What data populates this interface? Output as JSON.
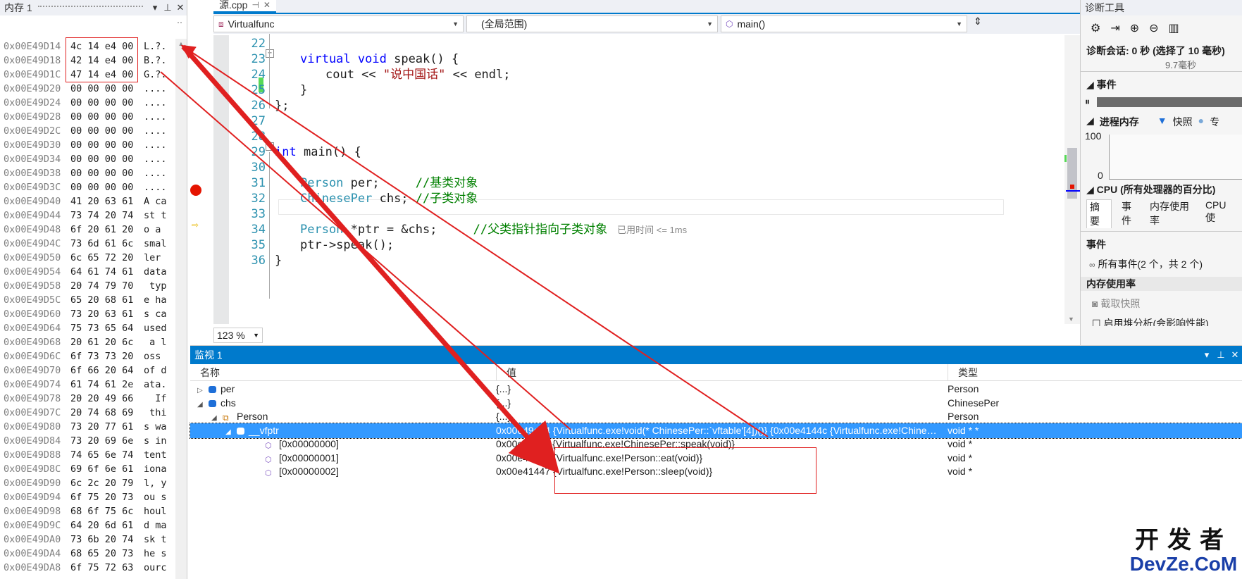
{
  "memory_panel": {
    "title": "内存 1",
    "rows": [
      {
        "addr": "0x00E49D14",
        "bytes": "4c 14 e4 00",
        "ascii": "L.?."
      },
      {
        "addr": "0x00E49D18",
        "bytes": "42 14 e4 00",
        "ascii": "B.?."
      },
      {
        "addr": "0x00E49D1C",
        "bytes": "47 14 e4 00",
        "ascii": "G.?."
      },
      {
        "addr": "0x00E49D20",
        "bytes": "00 00 00 00",
        "ascii": "...."
      },
      {
        "addr": "0x00E49D24",
        "bytes": "00 00 00 00",
        "ascii": "...."
      },
      {
        "addr": "0x00E49D28",
        "bytes": "00 00 00 00",
        "ascii": "...."
      },
      {
        "addr": "0x00E49D2C",
        "bytes": "00 00 00 00",
        "ascii": "...."
      },
      {
        "addr": "0x00E49D30",
        "bytes": "00 00 00 00",
        "ascii": "...."
      },
      {
        "addr": "0x00E49D34",
        "bytes": "00 00 00 00",
        "ascii": "...."
      },
      {
        "addr": "0x00E49D38",
        "bytes": "00 00 00 00",
        "ascii": "...."
      },
      {
        "addr": "0x00E49D3C",
        "bytes": "00 00 00 00",
        "ascii": "...."
      },
      {
        "addr": "0x00E49D40",
        "bytes": "41 20 63 61",
        "ascii": "A ca"
      },
      {
        "addr": "0x00E49D44",
        "bytes": "73 74 20 74",
        "ascii": "st t"
      },
      {
        "addr": "0x00E49D48",
        "bytes": "6f 20 61 20",
        "ascii": "o a "
      },
      {
        "addr": "0x00E49D4C",
        "bytes": "73 6d 61 6c",
        "ascii": "smal"
      },
      {
        "addr": "0x00E49D50",
        "bytes": "6c 65 72 20",
        "ascii": "ler "
      },
      {
        "addr": "0x00E49D54",
        "bytes": "64 61 74 61",
        "ascii": "data"
      },
      {
        "addr": "0x00E49D58",
        "bytes": "20 74 79 70",
        "ascii": " typ"
      },
      {
        "addr": "0x00E49D5C",
        "bytes": "65 20 68 61",
        "ascii": "e ha"
      },
      {
        "addr": "0x00E49D60",
        "bytes": "73 20 63 61",
        "ascii": "s ca"
      },
      {
        "addr": "0x00E49D64",
        "bytes": "75 73 65 64",
        "ascii": "used"
      },
      {
        "addr": "0x00E49D68",
        "bytes": "20 61 20 6c",
        "ascii": " a l"
      },
      {
        "addr": "0x00E49D6C",
        "bytes": "6f 73 73 20",
        "ascii": "oss "
      },
      {
        "addr": "0x00E49D70",
        "bytes": "6f 66 20 64",
        "ascii": "of d"
      },
      {
        "addr": "0x00E49D74",
        "bytes": "61 74 61 2e",
        "ascii": "ata."
      },
      {
        "addr": "0x00E49D78",
        "bytes": "20 20 49 66",
        "ascii": "  If"
      },
      {
        "addr": "0x00E49D7C",
        "bytes": "20 74 68 69",
        "ascii": " thi"
      },
      {
        "addr": "0x00E49D80",
        "bytes": "73 20 77 61",
        "ascii": "s wa"
      },
      {
        "addr": "0x00E49D84",
        "bytes": "73 20 69 6e",
        "ascii": "s in"
      },
      {
        "addr": "0x00E49D88",
        "bytes": "74 65 6e 74",
        "ascii": "tent"
      },
      {
        "addr": "0x00E49D8C",
        "bytes": "69 6f 6e 61",
        "ascii": "iona"
      },
      {
        "addr": "0x00E49D90",
        "bytes": "6c 2c 20 79",
        "ascii": "l, y"
      },
      {
        "addr": "0x00E49D94",
        "bytes": "6f 75 20 73",
        "ascii": "ou s"
      },
      {
        "addr": "0x00E49D98",
        "bytes": "68 6f 75 6c",
        "ascii": "houl"
      },
      {
        "addr": "0x00E49D9C",
        "bytes": "64 20 6d 61",
        "ascii": "d ma"
      },
      {
        "addr": "0x00E49DA0",
        "bytes": "73 6b 20 74",
        "ascii": "sk t"
      },
      {
        "addr": "0x00E49DA4",
        "bytes": "68 65 20 73",
        "ascii": "he s"
      },
      {
        "addr": "0x00E49DA8",
        "bytes": "6f 75 72 63",
        "ascii": "ourc"
      }
    ]
  },
  "editor": {
    "tab_label": "源.cpp",
    "nav_project": "Virtualfunc",
    "nav_scope": "(全局范围)",
    "nav_function": "main()",
    "zoom": "123 %",
    "elapsed_hint": "已用时间 <= 1ms",
    "line_numbers": [
      "22",
      "23",
      "24",
      "25",
      "26",
      "27",
      "28",
      "29",
      "30",
      "31",
      "32",
      "33",
      "34",
      "35",
      "36"
    ],
    "code": {
      "l23_kw1": "virtual",
      "l23_kw2": "void",
      "l23_rest": " speak() {",
      "l24_a": "cout << ",
      "l24_str": "\"说中国话\"",
      "l24_b": " << endl;",
      "l25": "}",
      "l26": "};",
      "l29_kw": "int",
      "l29_rest": " main() {",
      "l31_ty": "Person",
      "l31_rest": " per;     ",
      "l31_cm": "//基类对象",
      "l32_ty": "ChinesePer",
      "l32_rest": " chs; ",
      "l32_cm": "//子类对象",
      "l34_ty": "Person",
      "l34_rest": " *ptr = &chs;     ",
      "l34_cm": "//父类指针指向子类对象",
      "l35": "ptr->speak();",
      "l36": "}"
    }
  },
  "watch": {
    "title": "监视 1",
    "col_name": "名称",
    "col_value": "值",
    "col_type": "类型",
    "rows": [
      {
        "name": "per",
        "value": "{...}",
        "type": "Person"
      },
      {
        "name": "chs",
        "value": "{...}",
        "type": "ChinesePer"
      },
      {
        "name": "Person",
        "value": "{...}",
        "type": "Person"
      },
      {
        "name": "__vfptr",
        "value": "0x00e49d14 {Virtualfunc.exe!void(* ChinesePer::`vftable'[4])()} {0x00e4144c {Virtualfunc.exe!ChinesePer::spe...",
        "type": "void * *"
      },
      {
        "name": "[0x00000000]",
        "value": "0x00e4144c {Virtualfunc.exe!ChinesePer::speak(void)}",
        "type": "void *"
      },
      {
        "name": "[0x00000001]",
        "value": "0x00e41442 {Virtualfunc.exe!Person::eat(void)}",
        "type": "void *"
      },
      {
        "name": "[0x00000002]",
        "value": "0x00e41447 {Virtualfunc.exe!Person::sleep(void)}",
        "type": "void *"
      }
    ]
  },
  "diag": {
    "title": "诊断工具",
    "session": "诊断会话: 0 秒 (选择了 10 毫秒)",
    "timeline_label": "9.7毫秒",
    "events_header": "事件",
    "process_memory": "进程内存",
    "snapshot_legend": "快照",
    "private_legend": "专",
    "axis_100": "100",
    "axis_0": "0",
    "cpu_header": "CPU (所有处理器的百分比)",
    "tabs": [
      "摘要",
      "事件",
      "内存使用率",
      "CPU 使"
    ],
    "events_section": "事件",
    "all_events": "所有事件(2 个，共 2 个)",
    "memory_usage": "内存使用率",
    "take_snapshot": "截取快照",
    "heap_profiling": "启用堆分析(会影响性能)"
  },
  "watermark": {
    "line1": "开发者",
    "line2": "DevZe.CoM"
  },
  "colors": {
    "accent": "#007acc",
    "annotation": "#e02020",
    "selection": "#3399ff"
  }
}
